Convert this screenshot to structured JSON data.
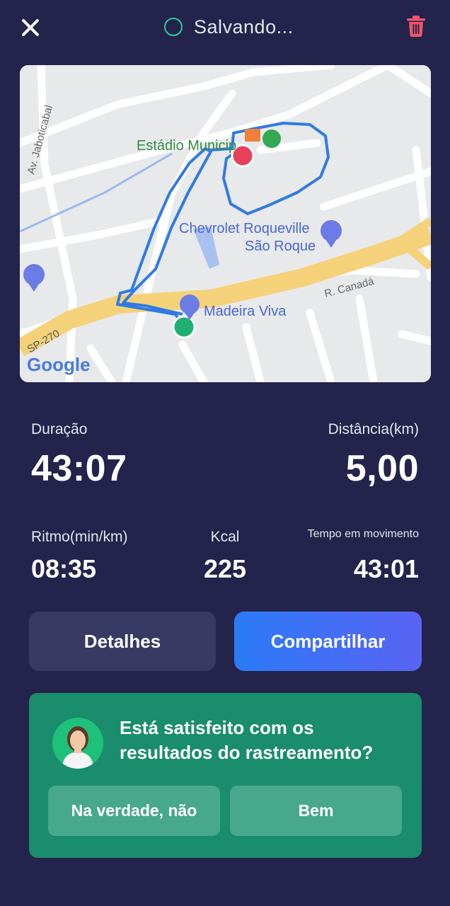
{
  "header": {
    "status": "Salvando...",
    "colors": {
      "spinner": "#2ecc9a",
      "trash": "#f0556b"
    }
  },
  "map": {
    "labels": {
      "stadium": "Estádio Municip",
      "chevrolet_line1": "Chevrolet Roqueville",
      "chevrolet_line2": "São Roque",
      "madeira": "Madeira Viva",
      "road_jaboticabal": "Av. Jaboticabal",
      "road_canada": "R. Canadá",
      "road_sp270": "SP-270",
      "google": "Google"
    }
  },
  "stats": {
    "duration": {
      "label": "Duração",
      "value": "43:07"
    },
    "distance": {
      "label": "Distância(km)",
      "value": "5,00"
    },
    "pace": {
      "label": "Ritmo(min/km)",
      "value": "08:35"
    },
    "kcal": {
      "label": "Kcal",
      "value": "225"
    },
    "moving": {
      "label": "Tempo em movimento",
      "value": "43:01"
    }
  },
  "actions": {
    "details": "Detalhes",
    "share": "Compartilhar"
  },
  "feedback": {
    "question": "Está satisfeito com os resultados do rastreamento?",
    "no": "Na verdade, não",
    "yes": "Bem"
  }
}
